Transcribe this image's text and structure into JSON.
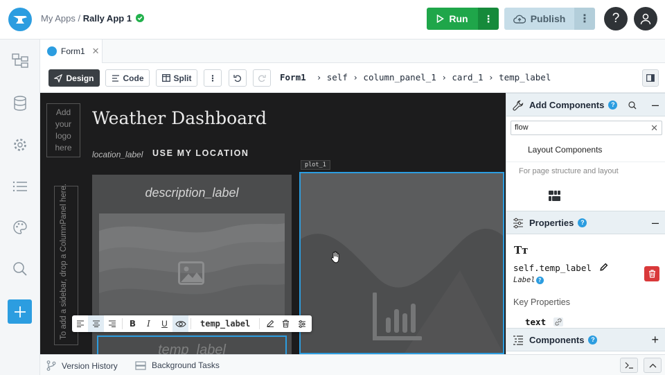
{
  "header": {
    "breadcrumb_parent": "My Apps",
    "breadcrumb_sep": "/",
    "app_name": "Rally App 1",
    "run_label": "Run",
    "publish_label": "Publish",
    "help_glyph": "?",
    "more_glyph": "⋮"
  },
  "tabs": [
    {
      "label": "Form1",
      "close": "✕"
    }
  ],
  "toolbar": {
    "design_label": "Design",
    "code_label": "Code",
    "split_label": "Split",
    "more_glyph": "⋮",
    "path_root": "Form1",
    "path": "› self › column_panel_1 › card_1 › temp_label"
  },
  "canvas": {
    "logo_placeholder": "Add your logo here",
    "sidebar_hint": "To add a sidebar, drop a ColumnPanel here.",
    "title": "Weather Dashboard",
    "location_label": "location_label",
    "location_button": "USE MY LOCATION",
    "description_label": "description_label",
    "temp_ghost": "temp_label",
    "plot_tag": "plot_1"
  },
  "floating_toolbar": {
    "component_name": "temp_label",
    "bold": "B",
    "italic": "I",
    "underline": "U"
  },
  "right_panel": {
    "add_components_title": "Add Components",
    "search_value": "flow",
    "search_clear": "✕",
    "layout_components": "Layout Components",
    "layout_description": "For page structure and layout",
    "properties_title": "Properties",
    "type_icon_text": "Tт",
    "prop_name": "self.temp_label",
    "prop_kind": "Label",
    "key_properties": "Key Properties",
    "text_prop": "text",
    "components_title": "Components",
    "collapse_glyph": "–",
    "expand_glyph": "+",
    "help_badge": "?"
  },
  "bottom": {
    "version_history": "Version History",
    "background_tasks": "Background Tasks"
  },
  "colors": {
    "accent": "#2c9de0",
    "run_green": "#1fa64a",
    "publish_bg": "#c6dde8",
    "delete_red": "#d9393a",
    "canvas_bg": "#1c1c1d"
  }
}
